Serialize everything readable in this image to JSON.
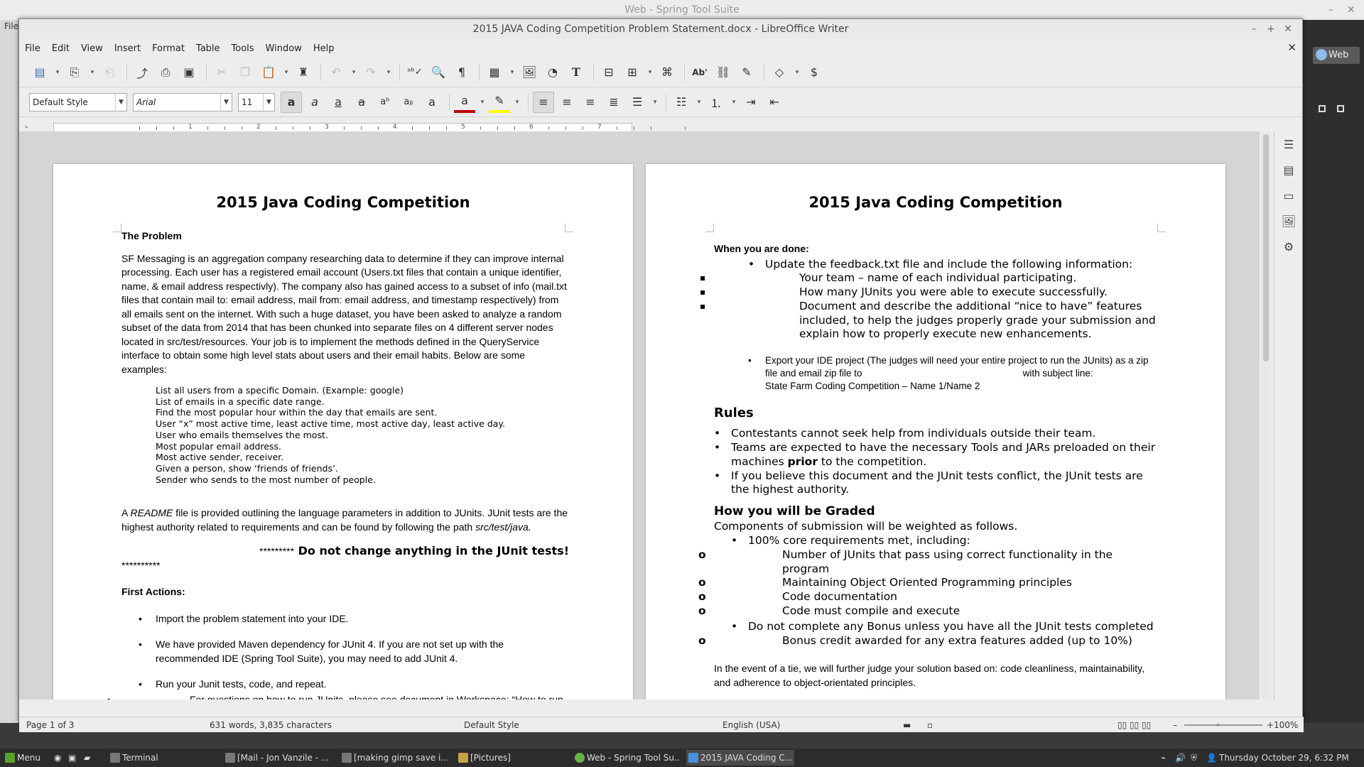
{
  "background_app": {
    "title": "Web - Spring Tool Suite",
    "left_menu": "File",
    "right_button": "Web"
  },
  "window": {
    "title": "2015 JAVA Coding Competition Problem Statement.docx - LibreOffice Writer",
    "menu": [
      "File",
      "Edit",
      "View",
      "Insert",
      "Format",
      "Table",
      "Tools",
      "Window",
      "Help"
    ]
  },
  "format_bar": {
    "style": "Default Style",
    "font": "Arial",
    "size": "11"
  },
  "ruler_numbers": [
    "1",
    "2",
    "3",
    "4",
    "5",
    "6",
    "7"
  ],
  "page1": {
    "header": "2015 Java Coding Competition",
    "problem_heading": "The Problem",
    "para1": "SF Messaging is an aggregation company researching data to determine if they can improve internal processing.  Each user has a registered email account (Users.txt files that contain a unique identifier, name, & email address respectivly).  The company also has gained access to a subset of info (mail.txt files that contain mail to:  email address, mail from:  email address, and timestamp respectively) from all emails sent on the internet.  With such a huge dataset, you have been asked to analyze a random subset of the data from 2014 that has been chunked into separate files on 4 different server nodes located in src/test/resources.  Your job is to implement the methods defined in the QueryService interface to obtain some high level stats about users and their email habits.  Below are some examples:",
    "examples": [
      "List all users from a specific Domain.  (Example:  google)",
      "List of emails in a specific date range.",
      "Find the most popular hour within the day that emails are sent.",
      "User “x” most active time, least active time, most active day, least active day.",
      "User who emails themselves the most.",
      "Most popular email address.",
      "Most active sender, receiver.",
      "Given a person, show ‘friends of friends’.",
      "Sender who sends to the most number of people."
    ],
    "readme_a": "A ",
    "readme_word": "README",
    "readme_b": " file is provided outlining the language parameters in addition to JUnits. JUnit tests are the highest authority related to requirements and can be found by following the path ",
    "readme_path": "src/test/java.",
    "warning_stars": "*********",
    "warning_text": " Do not change anything in the JUnit tests!",
    "warning_stars2": "**********",
    "first_actions": "First Actions:",
    "actions": [
      "Import the problem statement into your IDE.",
      "We have provided Maven dependency for JUnit 4.  If you are not set up with the recommended IDE (Spring Tool Suite), you may need to add JUnit 4.",
      "Run your Junit tests, code, and repeat."
    ],
    "sub_action": "For questions on how to run JUnits, please see document in Workspace:  “How to run JUnits”"
  },
  "page2": {
    "header": "2015 Java Coding Competition",
    "when_done": "When you are done:",
    "update": "Update the feedback.txt file and include the following information:",
    "update_items": [
      "Your team – name of each individual participating.",
      "How many JUnits you were able to execute successfully.",
      "Document and describe the additional “nice to have” features included, to help the judges properly grade your submission and explain how to properly execute new enhancements."
    ],
    "export_1": "Export your IDE project (The judges will need your entire project to run the JUnits) as a zip file and email zip file to",
    "export_2": "with subject line:",
    "export_3": "State Farm Coding Competition – Name 1/Name 2",
    "rules_heading": "Rules",
    "rules": [
      "Contestants cannot seek help from individuals outside their team.",
      "Teams are expected to have the necessary Tools and JARs preloaded on their machines ",
      "If you believe this document and the JUnit tests conflict, the JUnit tests are the highest authority."
    ],
    "rules_prior": "prior",
    "rules_tail": " to the competition.",
    "graded_heading": "How you will be Graded",
    "graded_intro": "Components of submission will be weighted as follows.",
    "core": "100% core requirements met, including:",
    "core_items": [
      "Number of JUnits that pass using correct functionality in the program",
      "Maintaining Object Oriented Programming principles",
      "Code documentation",
      "Code must compile and execute"
    ],
    "bonus": "Do not complete any Bonus unless you have all the JUnit tests completed",
    "bonus_item": "Bonus credit awarded for any extra features added (up to 10%)",
    "tie": "In the event of a tie, we will further judge your solution based on: code cleanliness, maintainability, and adherence to object-orientated principles."
  },
  "status": {
    "page": "Page 1 of 3",
    "words": "631 words, 3,835 characters",
    "style": "Default Style",
    "lang": "English (USA)",
    "zoom": "100%"
  },
  "taskbar": {
    "menu": "Menu",
    "items": [
      "Terminal",
      "[Mail - Jon Vanzile - ...",
      "[making gimp save i...",
      "[Pictures]",
      "Web - Spring Tool Su...",
      "2015 JAVA Coding C..."
    ],
    "clock": "Thursday October 29,  6:32 PM"
  },
  "colors": {
    "accent": "#4a90d9",
    "font_color": "#c00000",
    "highlight": "#ffff00",
    "spell": "#dd0000"
  },
  "icons": [
    "new-icon",
    "open-icon",
    "save-icon",
    "export-pdf-icon",
    "print-icon",
    "print-preview-icon",
    "cut-icon",
    "copy-icon",
    "paste-icon",
    "clone-icon",
    "undo-icon",
    "redo-icon",
    "spellcheck-icon",
    "find-icon",
    "formatting-marks-icon",
    "table-icon",
    "image-icon",
    "chart-icon",
    "textbox-icon",
    "page-break-icon",
    "field-icon",
    "special-char-icon",
    "hyperlink-icon",
    "comment-icon",
    "track-changes-icon",
    "draw-icon",
    "shapes-icon",
    "properties-icon",
    "styles-icon",
    "gallery-icon",
    "navigator-icon"
  ]
}
